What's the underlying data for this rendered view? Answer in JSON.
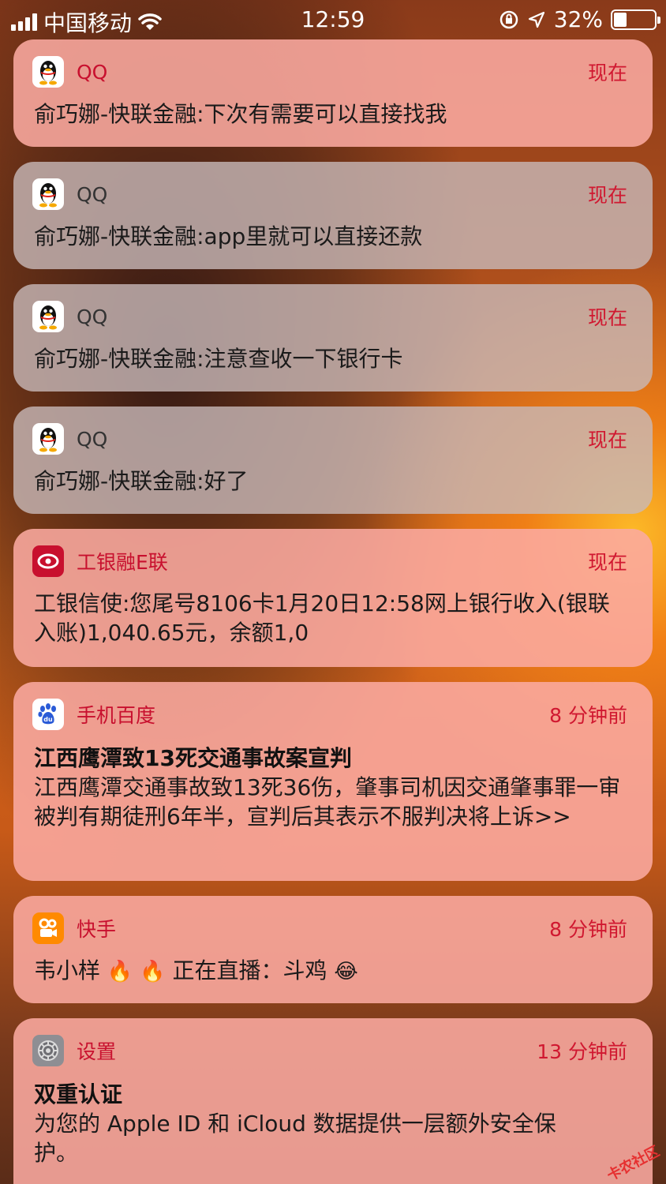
{
  "status_bar": {
    "carrier": "中国移动",
    "time": "12:59",
    "battery_percent": "32%",
    "battery_level": 0.32
  },
  "notifications": [
    {
      "app": "QQ",
      "time": "现在",
      "body": "俞巧娜-快联金融:下次有需要可以直接找我"
    },
    {
      "app": "QQ",
      "time": "现在",
      "body": "俞巧娜-快联金融:app里就可以直接还款"
    },
    {
      "app": "QQ",
      "time": "现在",
      "body": "俞巧娜-快联金融:注意查收一下银行卡"
    },
    {
      "app": "QQ",
      "time": "现在",
      "body": "俞巧娜-快联金融:好了"
    },
    {
      "app": "工银融E联",
      "time": "现在",
      "body": "工银信使:您尾号8106卡1月20日12:58网上银行收入(银联入账)1,040.65元，余额1,0"
    },
    {
      "app": "手机百度",
      "time": "8 分钟前",
      "title": "江西鹰潭致13死交通事故案宣判",
      "body": "江西鹰潭交通事故致13死36伤，肇事司机因交通肇事罪一审被判有期徒刑6年半，宣判后其表示不服判决将上诉>>"
    },
    {
      "app": "快手",
      "time": "8 分钟前",
      "body_name": "韦小样",
      "body_text": "正在直播：斗鸡"
    },
    {
      "app": "设置",
      "time": "13 分钟前",
      "title": "双重认证",
      "body": "为您的 Apple ID 和 iCloud 数据提供一层额外安全保护。"
    }
  ],
  "watermark": "卡农社区",
  "icons": {
    "qq": "qq-penguin-icon",
    "icbc": "icbc-logo-icon",
    "baidu": "baidu-paw-icon",
    "kuaishou": "kuaishou-camera-icon",
    "settings": "settings-gear-icon"
  }
}
